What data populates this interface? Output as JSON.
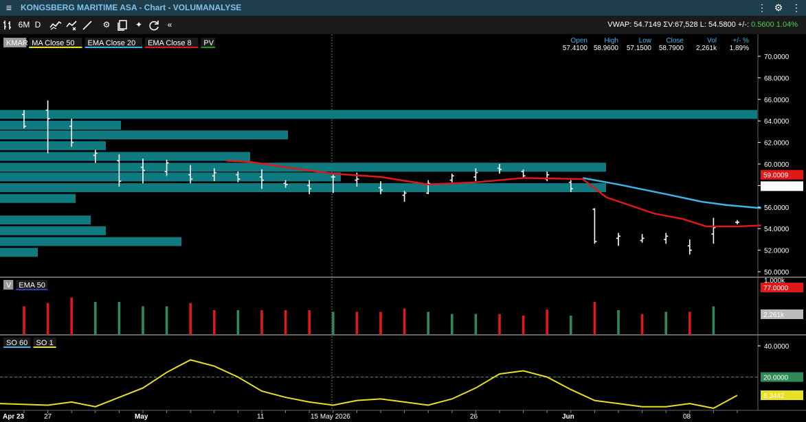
{
  "window": {
    "title": "KONGSBERG MARITIME ASA - Chart - VOLUMANALYSE"
  },
  "toolbar": {
    "period": "6M",
    "interval": "D",
    "collapse": "«"
  },
  "quote": {
    "vwap_label": "VWAP:",
    "vwap": "54.7149",
    "vol_label": "ΣV:",
    "vol": "67,528",
    "last_label": "L:",
    "last": "54.5800",
    "change_label": "+/-:",
    "change": "0.5600",
    "change_pct": "1.04%"
  },
  "legend_main": [
    {
      "label": "KMAR",
      "color": "#9a9a9a",
      "text_color": "#000000"
    },
    {
      "label": "MA Close 50",
      "color": "#e8e020"
    },
    {
      "label": "EMA Close 20",
      "color": "#3fb4ea"
    },
    {
      "label": "EMA Close 8",
      "color": "#e01818"
    },
    {
      "label": "PV",
      "color": "#1a9a1a"
    }
  ],
  "ohlc": {
    "headers": [
      "Open",
      "High",
      "Low",
      "Close",
      "Vol",
      "+/- %"
    ],
    "values": [
      "57.4100",
      "58.9600",
      "57.1500",
      "58.7900",
      "2,261k",
      "1.89%"
    ]
  },
  "price_axis": {
    "ticks": [
      "70.0000",
      "68.0000",
      "66.0000",
      "64.0000",
      "62.0000",
      "60.0000",
      "58.0000",
      "56.0000",
      "54.0000",
      "52.0000",
      "50.0000"
    ],
    "tag_red": "59.0009",
    "tag_white": "58.7900"
  },
  "volume_panel": {
    "legend": [
      {
        "label": "V",
        "color": "#9a9a9a"
      },
      {
        "label": "EMA 50",
        "color": "#2a3fb0"
      }
    ],
    "axis_top": "1,000k",
    "tag_red": "77.0000",
    "tag_gray": "2,261k"
  },
  "so_panel": {
    "legend": [
      {
        "label": "SO 60",
        "color": "#3fb4ea"
      },
      {
        "label": "SO 1",
        "color": "#e8e020"
      }
    ],
    "ticks": [
      "40.0000"
    ],
    "tag_green": "20.0000",
    "tag_yellow": "8.3442"
  },
  "x_axis": {
    "labels": [
      "Apr 23",
      "27",
      "May",
      "11",
      "15 May 2026",
      "26",
      "Jun",
      "08"
    ]
  },
  "chart_data": {
    "type": "ohlc",
    "price": {
      "ylim": [
        50,
        70.5
      ],
      "bars": [
        {
          "h": 65.0,
          "l": 63.3,
          "o": 64.6,
          "c": 63.5
        },
        {
          "h": 65.9,
          "l": 61.0,
          "o": 65.0,
          "c": 64.2
        },
        {
          "h": 64.2,
          "l": 61.6,
          "o": 63.5,
          "c": 62.0
        },
        {
          "h": 61.3,
          "l": 60.1,
          "o": 60.8,
          "c": 61.0
        },
        {
          "h": 60.9,
          "l": 57.9,
          "o": 60.3,
          "c": 58.4
        },
        {
          "h": 60.5,
          "l": 58.2,
          "o": 59.7,
          "c": 59.4
        },
        {
          "h": 60.4,
          "l": 58.9,
          "o": 59.3,
          "c": 60.1
        },
        {
          "h": 59.9,
          "l": 58.2,
          "o": 59.0,
          "c": 58.6
        },
        {
          "h": 59.6,
          "l": 58.4,
          "o": 58.9,
          "c": 59.2
        },
        {
          "h": 59.3,
          "l": 58.3,
          "o": 59.0,
          "c": 58.6
        },
        {
          "h": 59.5,
          "l": 57.7,
          "o": 58.8,
          "c": 58.5
        },
        {
          "h": 58.5,
          "l": 57.8,
          "o": 58.2,
          "c": 58.1
        },
        {
          "h": 58.5,
          "l": 57.2,
          "o": 58.0,
          "c": 57.7
        },
        {
          "h": 59.0,
          "l": 57.3,
          "o": 58.8,
          "c": 58.8
        },
        {
          "h": 59.2,
          "l": 57.9,
          "o": 58.5,
          "c": 58.6
        },
        {
          "h": 58.4,
          "l": 57.2,
          "o": 57.8,
          "c": 57.6
        },
        {
          "h": 57.5,
          "l": 56.5,
          "o": 57.1,
          "c": 57.3
        },
        {
          "h": 58.5,
          "l": 57.2,
          "o": 57.3,
          "c": 58.2
        },
        {
          "h": 59.1,
          "l": 58.3,
          "o": 58.5,
          "c": 58.9
        },
        {
          "h": 59.6,
          "l": 58.4,
          "o": 58.8,
          "c": 59.2
        },
        {
          "h": 60.0,
          "l": 59.1,
          "o": 59.6,
          "c": 59.5
        },
        {
          "h": 59.5,
          "l": 58.7,
          "o": 59.3,
          "c": 58.9
        },
        {
          "h": 59.3,
          "l": 58.4,
          "o": 58.6,
          "c": 59.0
        },
        {
          "h": 58.5,
          "l": 57.4,
          "o": 58.3,
          "c": 57.7
        },
        {
          "h": 55.9,
          "l": 52.6,
          "o": 55.8,
          "c": 52.8
        },
        {
          "h": 53.6,
          "l": 52.4,
          "o": 53.1,
          "c": 53.3
        },
        {
          "h": 53.5,
          "l": 52.7,
          "o": 52.9,
          "c": 53.1
        },
        {
          "h": 53.6,
          "l": 52.6,
          "o": 53.0,
          "c": 53.3
        },
        {
          "h": 53.0,
          "l": 51.6,
          "o": 52.4,
          "c": 52.0
        },
        {
          "h": 55.0,
          "l": 52.6,
          "o": 53.5,
          "c": 54.1
        },
        {
          "h": 54.8,
          "l": 54.4,
          "o": 54.6,
          "c": 54.6
        }
      ],
      "ema8": [
        {
          "i": 8.5,
          "v": 60.3
        },
        {
          "i": 9.5,
          "v": 60.2
        },
        {
          "i": 11,
          "v": 59.7
        },
        {
          "i": 13,
          "v": 59.1
        },
        {
          "i": 15,
          "v": 58.8
        },
        {
          "i": 17,
          "v": 58.1
        },
        {
          "i": 19,
          "v": 58.3
        },
        {
          "i": 21,
          "v": 58.7
        },
        {
          "i": 23.5,
          "v": 58.6
        },
        {
          "i": 24.5,
          "v": 56.9
        },
        {
          "i": 26.5,
          "v": 55.4
        },
        {
          "i": 27.7,
          "v": 54.9
        },
        {
          "i": 28.7,
          "v": 54.2
        },
        {
          "i": 30,
          "v": 54.2
        },
        {
          "i": 31,
          "v": 54.3
        }
      ],
      "ema20": [
        {
          "i": 23.5,
          "v": 58.7
        },
        {
          "i": 25,
          "v": 58.1
        },
        {
          "i": 27,
          "v": 57.2
        },
        {
          "i": 28.5,
          "v": 56.5
        },
        {
          "i": 29.5,
          "v": 56.2
        },
        {
          "i": 31,
          "v": 55.9
        }
      ],
      "volume_profile": [
        {
          "price": 64.6,
          "width": 1.0
        },
        {
          "price": 63.6,
          "width": 0.16
        },
        {
          "price": 62.7,
          "width": 0.38
        },
        {
          "price": 61.7,
          "width": 0.14
        },
        {
          "price": 60.7,
          "width": 0.33
        },
        {
          "price": 59.7,
          "width": 0.8
        },
        {
          "price": 58.8,
          "width": 0.45
        },
        {
          "price": 57.8,
          "width": 0.8
        },
        {
          "price": 56.8,
          "width": 0.1
        },
        {
          "price": 54.8,
          "width": 0.12
        },
        {
          "price": 53.8,
          "width": 0.14
        },
        {
          "price": 52.8,
          "width": 0.24
        },
        {
          "price": 51.8,
          "width": 0.05
        }
      ]
    },
    "volume": {
      "values": [
        0.52,
        0.58,
        0.68,
        0.6,
        0.6,
        0.52,
        0.52,
        0.58,
        0.45,
        0.45,
        0.45,
        0.45,
        0.45,
        0.42,
        0.42,
        0.42,
        0.48,
        0.42,
        0.38,
        0.38,
        0.38,
        0.35,
        0.46,
        0.35,
        0.6,
        0.45,
        0.38,
        0.42,
        0.42,
        0.52
      ],
      "colors": [
        "r",
        "r",
        "r",
        "g",
        "g",
        "g",
        "g",
        "r",
        "r",
        "g",
        "r",
        "r",
        "r",
        "g",
        "r",
        "r",
        "r",
        "g",
        "g",
        "g",
        "r",
        "r",
        "r",
        "g",
        "r",
        "g",
        "r",
        "g",
        "r",
        "g"
      ]
    },
    "so": {
      "ylim": [
        0,
        45
      ],
      "so1": [
        3.0,
        2.0,
        4.0,
        1.0,
        7.0,
        13.0,
        23.0,
        31.0,
        27.0,
        20.0,
        11.0,
        7.0,
        4.0,
        2.0,
        5.0,
        6.0,
        4.0,
        2.0,
        6.0,
        13.0,
        22.0,
        24.0,
        20.0,
        12.0,
        5.0,
        3.0,
        1.0,
        1.0,
        3.0,
        0.0,
        8.3
      ],
      "reference": 20.0
    }
  }
}
